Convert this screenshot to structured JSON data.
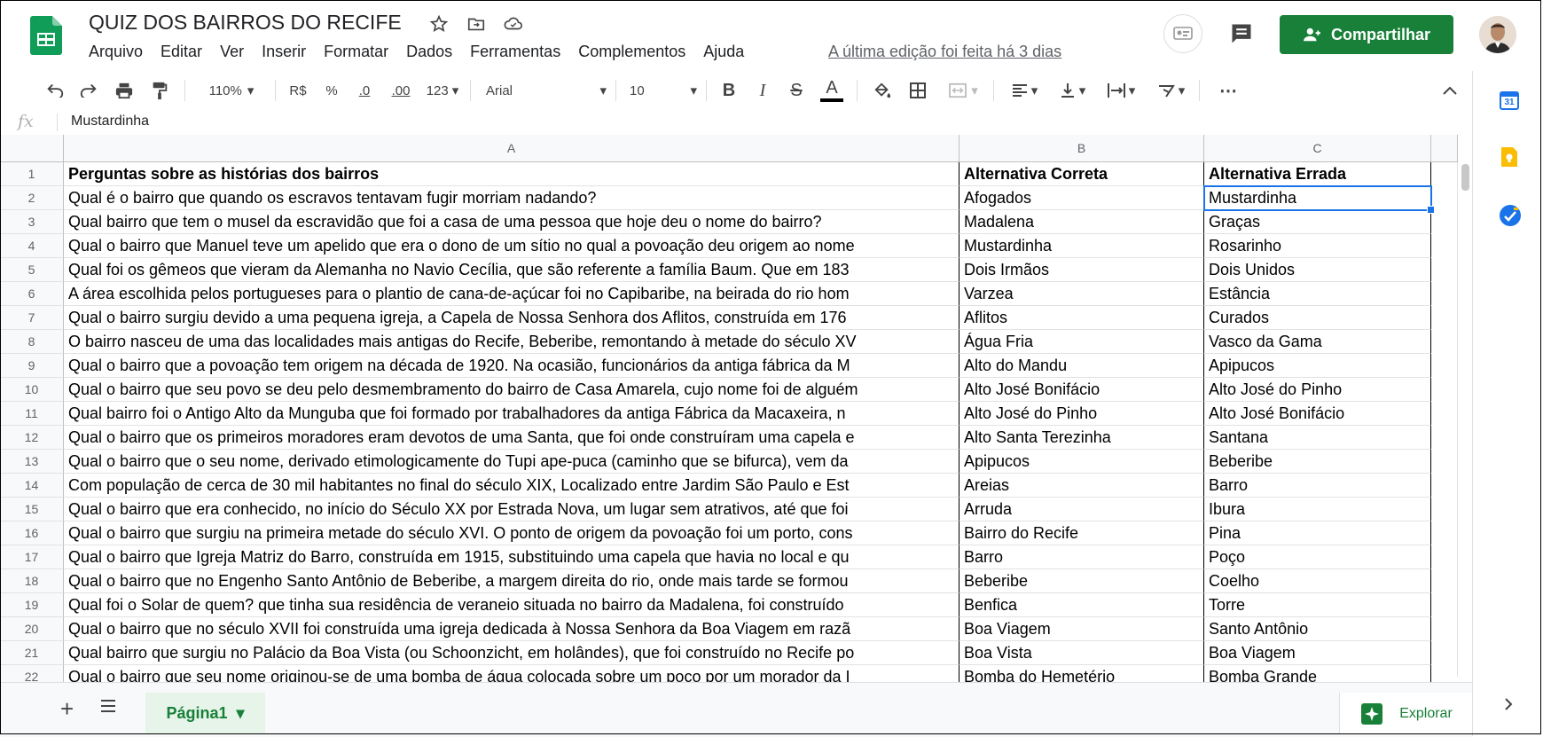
{
  "doc": {
    "title": "QUIZ DOS BAIRROS DO RECIFE",
    "last_edit": "A última edição foi feita há 3 dias"
  },
  "menu": [
    "Arquivo",
    "Editar",
    "Ver",
    "Inserir",
    "Formatar",
    "Dados",
    "Ferramentas",
    "Complementos",
    "Ajuda"
  ],
  "share_label": "Compartilhar",
  "toolbar": {
    "zoom": "110%",
    "currency": "R$",
    "percent": "%",
    "dec_less": ".0",
    "dec_more": ".00",
    "format_more": "123",
    "font": "Arial",
    "font_size": "10",
    "more": "⋯"
  },
  "formula": {
    "fx": "fx",
    "value": "Mustardinha"
  },
  "columns": [
    "A",
    "B",
    "C"
  ],
  "rows": [
    {
      "n": "1",
      "a": "Perguntas sobre as histórias dos bairros",
      "b": "Alternativa Correta",
      "c": "Alternativa Errada"
    },
    {
      "n": "2",
      "a": "Qual é o bairro que quando os escravos tentavam fugir morriam nadando?",
      "b": "Afogados",
      "c": "Mustardinha"
    },
    {
      "n": "3",
      "a": "Qual bairro que tem o musel da escravidão que foi a casa de uma pessoa que hoje deu o nome do bairro?",
      "b": "Madalena",
      "c": "Graças"
    },
    {
      "n": "4",
      "a": "Qual o bairro que Manuel teve um apelido que era o dono de um sítio no qual a povoação deu origem ao nome",
      "b": "Mustardinha",
      "c": "Rosarinho"
    },
    {
      "n": "5",
      "a": "Qual foi os gêmeos que vieram da Alemanha no Navio Cecília, que são referente a família Baum. Que em 183",
      "b": "Dois Irmãos",
      "c": "Dois Unidos"
    },
    {
      "n": "6",
      "a": "A área escolhida pelos portugueses para o plantio de cana-de-açúcar foi no Capibaribe, na beirada do rio hom",
      "b": "Varzea",
      "c": "Estância"
    },
    {
      "n": "7",
      "a": "Qual o bairro surgiu devido a uma pequena igreja, a Capela de Nossa Senhora dos Aflitos, construída em 176",
      "b": "Aflitos",
      "c": "Curados"
    },
    {
      "n": "8",
      "a": "O bairro nasceu de uma das localidades mais antigas do Recife, Beberibe, remontando à metade do século XV",
      "b": "Água Fria",
      "c": "Vasco da Gama"
    },
    {
      "n": "9",
      "a": "Qual o bairro que a povoação tem origem na década de 1920. Na ocasião, funcionários da antiga fábrica da M",
      "b": "Alto do Mandu",
      "c": "Apipucos"
    },
    {
      "n": "10",
      "a": "Qual o bairro que seu povo se deu pelo desmembramento do bairro de Casa Amarela, cujo nome foi de alguém",
      "b": "Alto José Bonifácio",
      "c": "Alto José do Pinho"
    },
    {
      "n": "11",
      "a": "Qual bairro foi o Antigo Alto da Munguba que foi formado por trabalhadores da antiga Fábrica da Macaxeira, n",
      "b": "Alto José do Pinho",
      "c": "Alto José Bonifácio"
    },
    {
      "n": "12",
      "a": "Qual o bairro que os primeiros moradores eram devotos de uma Santa, que foi onde construíram uma capela e",
      "b": "Alto Santa Terezinha",
      "c": "Santana"
    },
    {
      "n": "13",
      "a": "Qual o bairro que o seu nome, derivado etimologicamente do Tupi ape-puca (caminho que se bifurca), vem da",
      "b": "Apipucos",
      "c": "Beberibe"
    },
    {
      "n": "14",
      "a": "Com população de cerca de 30 mil habitantes no final do século XIX, Localizado entre Jardim São Paulo e Est",
      "b": "Areias",
      "c": "Barro"
    },
    {
      "n": "15",
      "a": "Qual o bairro que era conhecido, no início do Século XX por Estrada Nova, um lugar sem atrativos, até que foi",
      "b": "Arruda",
      "c": "Ibura"
    },
    {
      "n": "16",
      "a": "Qual o bairro que surgiu na primeira metade do século XVI. O ponto de origem da povoação foi um porto, cons",
      "b": "Bairro do Recife",
      "c": "Pina"
    },
    {
      "n": "17",
      "a": "Qual o bairro que Igreja Matriz do Barro, construída em 1915, substituindo uma capela que havia no local e qu",
      "b": "Barro",
      "c": "Poço"
    },
    {
      "n": "18",
      "a": "Qual o bairro que no Engenho Santo Antônio de Beberibe, a margem direita do rio, onde mais tarde se formou",
      "b": "Beberibe",
      "c": "Coelho"
    },
    {
      "n": "19",
      "a": "Qual foi o Solar de quem? que tinha sua residência de veraneio situada no bairro da Madalena, foi construído",
      "b": "Benfica",
      "c": "Torre"
    },
    {
      "n": "20",
      "a": "Qual o bairro que no século XVII foi construída uma igreja dedicada à Nossa Senhora da Boa Viagem em razã",
      "b": "Boa Viagem",
      "c": "Santo Antônio"
    },
    {
      "n": "21",
      "a": "Qual bairro que surgiu no Palácio da Boa Vista (ou Schoonzicht, em holândes), que foi construído no Recife po",
      "b": "Boa Vista",
      "c": "Boa Viagem"
    },
    {
      "n": "22",
      "a": "Qual o bairro que seu nome originou-se de uma bomba de água colocada sobre um poço por um morador da I",
      "b": "Bomba do Hemetério",
      "c": "Bomba Grande"
    }
  ],
  "sheet_tab": "Página1",
  "explore_label": "Explorar",
  "calendar_day": "31"
}
